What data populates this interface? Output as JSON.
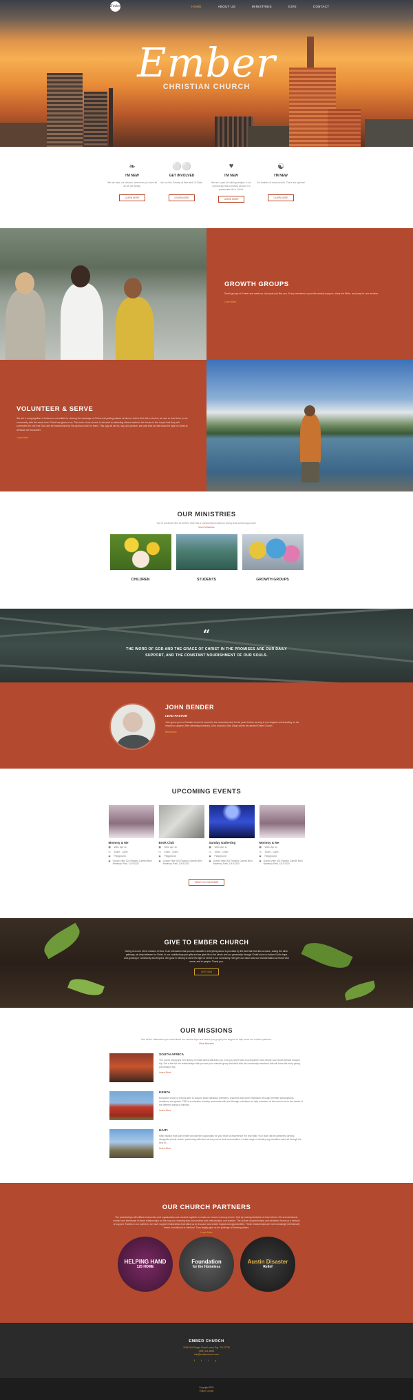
{
  "nav": {
    "logo": "Ember",
    "items": [
      "HOME",
      "ABOUT US",
      "MINISTRIES",
      "GIVE",
      "CONTACT"
    ]
  },
  "hero": {
    "title": "Ember",
    "subtitle": "CHRISTIAN CHURCH"
  },
  "intro": [
    {
      "icon": "leaf-icon",
      "title": "I'M NEW",
      "text": "We are new, our mission, wherever you have all all we are family.",
      "button": "LEARN MORE"
    },
    {
      "icon": "bicycle-icon",
      "title": "GET INVOLVED",
      "text": "Join us this Sunday at 9am and 10:30am.",
      "button": "LEARN MORE"
    },
    {
      "icon": "heart-icon",
      "title": "I'M NEW",
      "text": "We are a part of building bridges in our community that connects people in a passionate life in Christ.",
      "button": "LEARN MORE"
    },
    {
      "icon": "person-icon",
      "title": "I'M NEW",
      "text": "For families of every month. There are options!",
      "button": "LEARN MORE"
    }
  ],
  "growth": {
    "title": "GROWTH GROUPS",
    "text": "Small groups at Ember are made up of people just like you. Every members to provide weekly support, study the Bible, and pray for one another.",
    "link": "Learn More"
  },
  "volunteer": {
    "title": "VOLUNTEER & SERVE",
    "text": "We are a congregation of believers committed to sharing the message of Christ and putting values centered, fruit-in their life a church; we aim to love them in our community with the same love Christ has given to us. The work of our church is devoted to attracting others inside to the house in the hopes that they will surrender the one true God and be transformed by His glorious love for them. This ugly all we do, say, and preach, we pray that we will show the light of Christ to all those we encounter.",
    "link": "Learn More"
  },
  "ministries": {
    "title": "OUR MINISTRIES",
    "text": "You're not alone here at Ember! Give this a community focused on loving God and loving people.",
    "link": "More Ministries",
    "cards": [
      "CHILDREN",
      "STUDENTS",
      "GROWTH GROUPS"
    ]
  },
  "quote": {
    "text": "THE WORD OF GOD AND THE GRACE OF CHRIST IN THE PROMISES ARE OUR DAILY SUPPORT, AND THE CONSTANT NOURISHMENT OF OUR SOULS."
  },
  "pastor": {
    "name": "JOHN BENDER",
    "role": "LEAD PASTOR",
    "text": "John grew up in a Christian home he moved to the mountains and for his years before serving in Los Angeles and traveling on his mission to appear. After attending seminary, John moved to San Diego where he planted Ember Church.",
    "link": "Read More"
  },
  "events": {
    "title": "UPCOMING EVENTS",
    "items": [
      {
        "title": "Mommy & Me",
        "date": "Wed. Apr 11",
        "time": "10am - 12pm",
        "place": "Playground",
        "address": "Ocean View 301 Rancho Carmel Blvd Newbury Park, CA 91320"
      },
      {
        "title": "Book Club",
        "date": "Wed. Apr 11",
        "time": "10am - 12pm",
        "place": "Playground",
        "address": "Ocean View 301 Rancho Carmel Blvd Newbury Park, CA 91320"
      },
      {
        "title": "Sunday Gathering",
        "date": "Wed. Apr 11",
        "time": "10am - 12pm",
        "place": "Playground",
        "address": "Ocean View 301 Rancho Carmel Blvd Newbury Park, CA 91320"
      },
      {
        "title": "Mommy & Me",
        "date": "Wed. Apr 11",
        "time": "10am - 12pm",
        "place": "Playground",
        "address": "Ocean View 301 Rancho Carmel Blvd Newbury Park, CA 91320"
      }
    ],
    "button": "VIEW FULL CALENDAR"
  },
  "give": {
    "title": "GIVE TO EMBER CHURCH",
    "text": "Giving is a core of the mission of God. In an interaction that you are valuable in everything about is provided by the fact that God lets us have, during the other pathway, we help believers in Christ. In our contributing your gifts and we give life to the whole and our generosity through Christ's love to further God's hope and growing in community and beyond. We grow in striving to shine the light of Christ in our community. We give our vision and our transformation as those who serve, and in people. Thank you.",
    "button": "GIVE NOW"
  },
  "missions": {
    "title": "OUR MISSIONS",
    "text": "See all the information you need about our mission trips and where you go get your support to help serve our mission partners.",
    "link": "More Missions",
    "items": [
      {
        "title": "SOUTH AFRICA",
        "text": "The Lord's loving and rich history of South Africa will draw you in as you serve with a local partner and decide your South African mission trip. Get a feel for the relationships that you and your mission group will build with the community members that will know the story giving you mission trip.",
        "link": "Learn More"
      },
      {
        "title": "KENYA",
        "text": "European Union of Kenya aims to support local individual members, churches and other institutions through member subscriptions, donations and grants. TNE is a volunteer ministry and works with and through volunteers to help members of the church serve the needs of the different areas of ministry.",
        "link": "Learn More"
      },
      {
        "title": "HAITI",
        "text": "Haiti mission trips with Ember provide the opportunity for your team to experience the real Haiti. Your team will be partnered directly alongside a local church, partnering with them as they serve their communities. A wide range of ministry opportunities exist, all through the lens of...",
        "link": "Learn More"
      }
    ]
  },
  "partners": {
    "title": "OUR CHURCH PARTNERS",
    "text": "The partnerships with different churches and organizations are created together to make our church a strong church. God by making disciples of Jesus Christ. We are intentional, mindful and intentional in these relationships for the long run, learning from one another and networking to one another. The culture of partnerships and ministries forms up a network of support. Thanks to our partners, we have support relationships that allow us to resource and create impact and opportunities. These relationships are not increasingly intentionally driven, formational or habitual. They largely give us the privilege of blessing others.",
    "link": "Learn More",
    "logos": [
      {
        "line1": "HELPING HAND",
        "line2": "125 HOME"
      },
      {
        "line1": "Foundation",
        "line2": "for the Homeless"
      },
      {
        "line1": "Austin Disaster",
        "line2": "Relief"
      }
    ]
  },
  "footer": {
    "name": "EMBER CHURCH",
    "address": "3098 Old Slinger Road Lorem Erg. TN 37738",
    "phone": "(865) 111-8861",
    "email": "info@emberchurch.com",
    "socials": [
      "f",
      "t",
      "i",
      "y"
    ],
    "copyright": "Copyright 2021",
    "brand": "Ember Church"
  },
  "colors": {
    "rust": "#b3492f",
    "gold": "#f2b23a",
    "dark": "#2b2b2b"
  }
}
